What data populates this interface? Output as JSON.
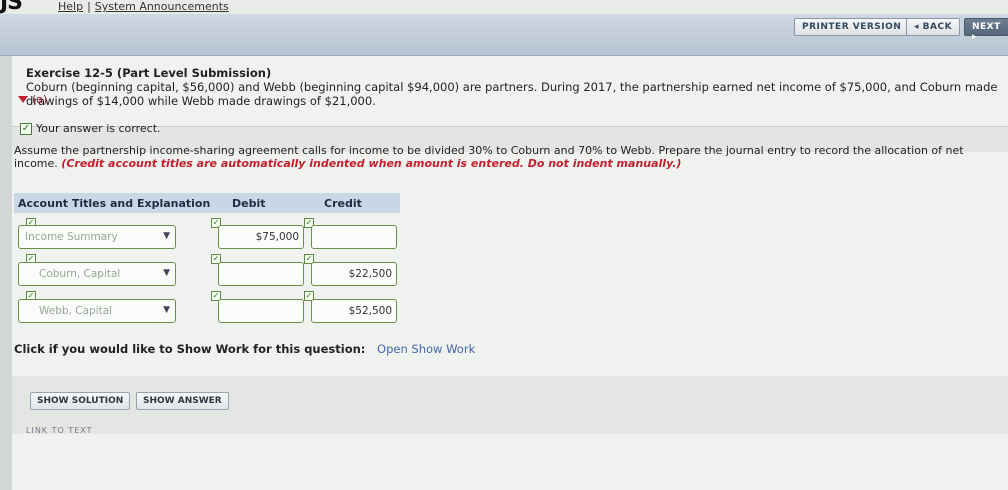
{
  "topbar": {
    "logo": "JS",
    "help": "Help",
    "separator": "|",
    "announcements": "System Announcements"
  },
  "nav": {
    "printer": "PRINTER VERSION",
    "back": "◂ BACK",
    "next": "NEXT ▸"
  },
  "exercise": {
    "title": "Exercise 12-5 (Part Level Submission)",
    "body": "Coburn (beginning capital, $56,000) and Webb (beginning capital $94,000) are partners. During 2017, the partnership earned net income of $75,000, and Coburn made drawings of $14,000 while Webb made drawings of $21,000."
  },
  "part": {
    "label": "(a)",
    "status": "Your answer is correct."
  },
  "instructions": {
    "text": "Assume the partnership income-sharing agreement calls for income to be divided 30% to Coburn and 70% to Webb. Prepare the journal entry to record the allocation of net income.",
    "note": "(Credit account titles are automatically indented when amount is entered. Do not indent manually.)"
  },
  "journal": {
    "headers": {
      "account": "Account Titles and Explanation",
      "debit": "Debit",
      "credit": "Credit"
    },
    "rows": [
      {
        "account": "Income Summary",
        "debit": "$75,000",
        "credit": ""
      },
      {
        "account": "Coburn, Capital",
        "debit": "",
        "credit": "$22,500"
      },
      {
        "account": "Webb, Capital",
        "debit": "",
        "credit": "$52,500"
      }
    ]
  },
  "showwork": {
    "prompt": "Click if you would like to Show Work for this question:",
    "link": "Open Show Work"
  },
  "actions": {
    "solution": "SHOW SOLUTION",
    "answer": "SHOW ANSWER",
    "linktext": "LINK TO TEXT"
  }
}
